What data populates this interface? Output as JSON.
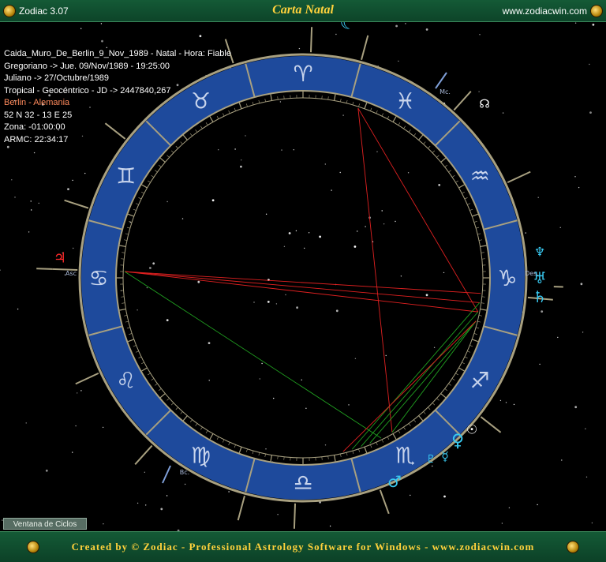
{
  "window": {
    "app_name": "Zodiac 3.07",
    "title": "Carta Natal",
    "url": "www.zodiacwin.com"
  },
  "chart_info": [
    {
      "text": "Caida_Muro_De_Berlin_9_Nov_1989 - Natal - Hora: Fiable",
      "color": "white"
    },
    {
      "text": "Gregoriano -> Jue. 09/Nov/1989 - 19:25:00",
      "color": "white"
    },
    {
      "text": "Juliano -> 27/Octubre/1989",
      "color": "white"
    },
    {
      "text": "Tropical - Geocéntrico - JD -> 2447840,267",
      "color": "white"
    },
    {
      "text": "Berlin - Alemania",
      "color": "orange"
    },
    {
      "text": "52 N 32 - 13 E 25",
      "color": "white"
    },
    {
      "text": "Zona: -01:00:00",
      "color": "white"
    },
    {
      "text": "ARMC: 22:34:17",
      "color": "white"
    }
  ],
  "angles": {
    "asc": "Asc",
    "mc": "Mc.",
    "desc": "Des.",
    "bc": "Bc."
  },
  "zodiac_signs": [
    "♋",
    "♊",
    "♉",
    "♈",
    "♓",
    "♒",
    "♑",
    "♐",
    "♏",
    "♎",
    "♍",
    "♌"
  ],
  "planet_glyphs": {
    "moon": "☾",
    "node": "☊",
    "neptune": "♆",
    "uranus": "♅",
    "saturn": "♄",
    "sun": "☉",
    "venus": "♀",
    "mercury": "☿",
    "mars": "♂",
    "jupiter": "♃",
    "pluto": "♇"
  },
  "colors": {
    "wheel_band": "#1e4a9c",
    "wheel_border": "#a8a080",
    "sign_glyph": "#c8d4ec",
    "planet": "#38c8f0",
    "jupiter": "#ff2a2a",
    "aspect_red": "#e02020",
    "aspect_green": "#20a020"
  },
  "bottom_tab": "Ventana de Ciclos",
  "footer_text": "Created by © Zodiac - Professional Astrology Software for Windows - www.zodiacwin.com"
}
